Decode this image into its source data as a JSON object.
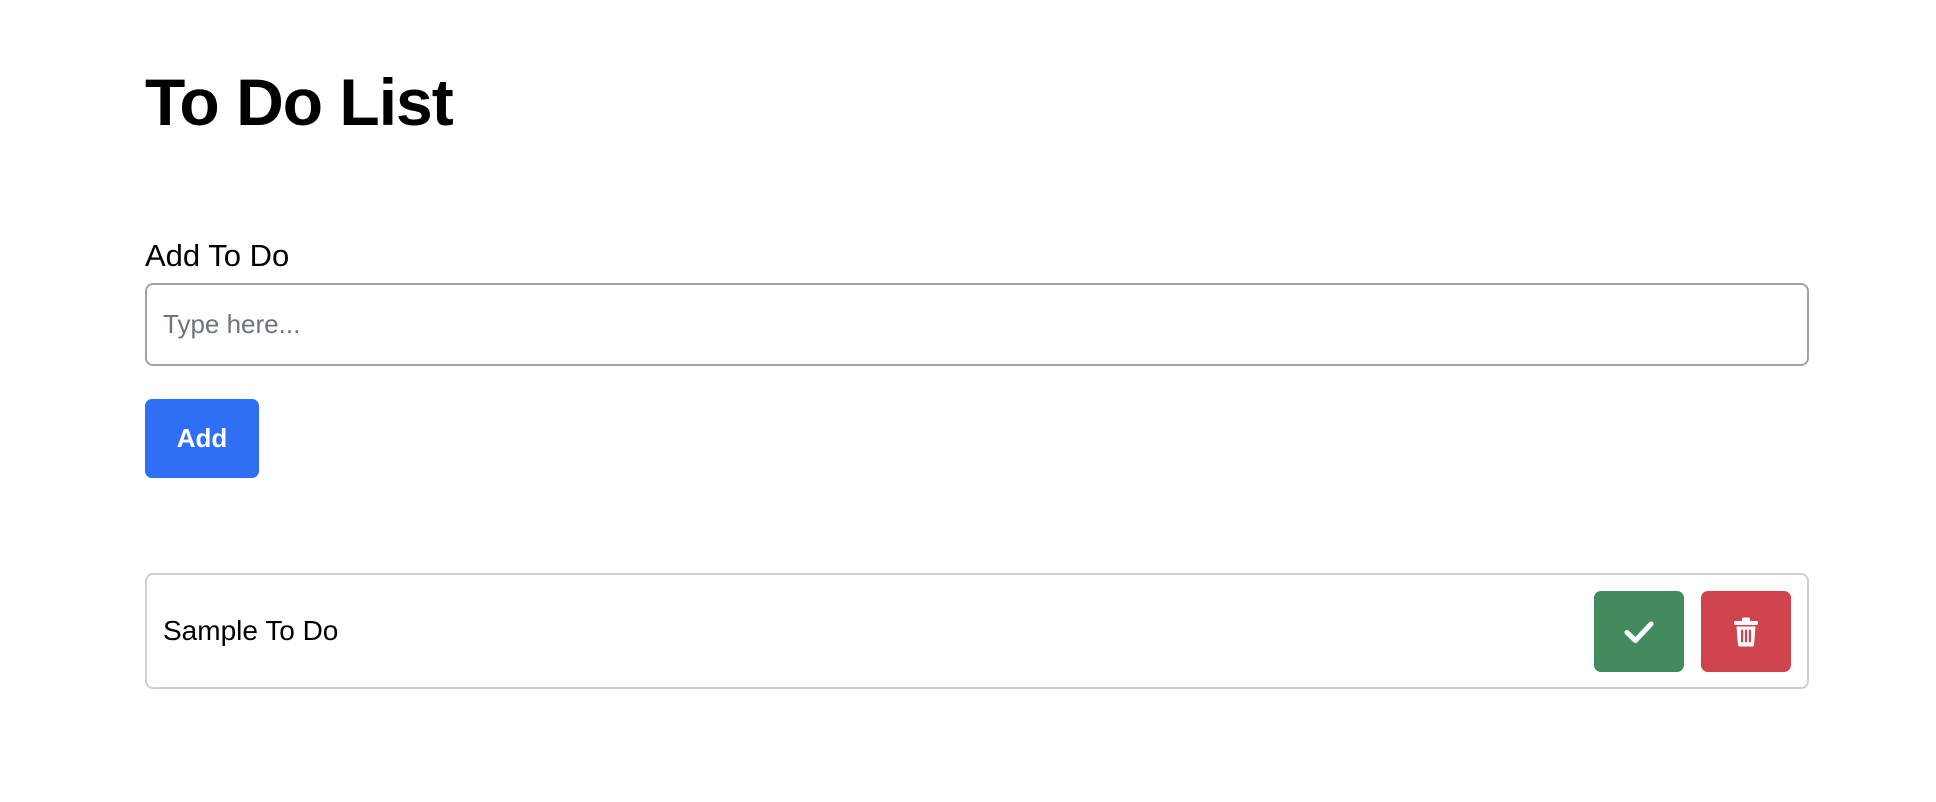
{
  "page": {
    "title": "To Do List"
  },
  "form": {
    "label": "Add To Do",
    "input_value": "",
    "placeholder": "Type here...",
    "add_label": "Add"
  },
  "todos": [
    {
      "text": "Sample To Do",
      "complete_icon": "check-icon",
      "delete_icon": "trash-icon"
    }
  ],
  "colors": {
    "primary": "#2f6ff3",
    "success": "#438a5e",
    "danger": "#cf444d",
    "border": "#cfcfcf",
    "input_border": "#a3a3a3"
  }
}
